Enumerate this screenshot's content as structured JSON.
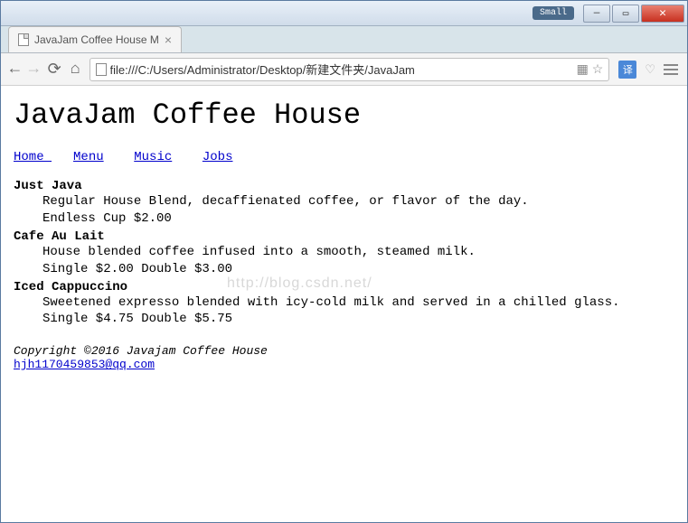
{
  "window": {
    "small_label": "Small"
  },
  "tab": {
    "title": "JavaJam Coffee House M"
  },
  "addressbar": {
    "url": "file:///C:/Users/Administrator/Desktop/新建文件夹/JavaJam"
  },
  "page": {
    "heading": "JavaJam Coffee House",
    "nav": [
      "Home ",
      "Menu",
      "Music",
      "Jobs"
    ],
    "menu": [
      {
        "name": "Just Java",
        "desc": "Regular House Blend, decaffienated coffee, or flavor of the day.",
        "price": "Endless Cup $2.00"
      },
      {
        "name": "Cafe Au Lait",
        "desc": "House blended coffee infused into a smooth, steamed milk.",
        "price": "Single $2.00 Double $3.00"
      },
      {
        "name": "Iced Cappuccino",
        "desc": "Sweetened expresso blended with icy-cold milk and served in a chilled glass.",
        "price": "Single $4.75 Double $5.75"
      }
    ],
    "copyright": "Copyright ©2016 Javajam Coffee House",
    "email": "hjh1170459853@qq.com"
  },
  "watermark": "http://blog.csdn.net/"
}
